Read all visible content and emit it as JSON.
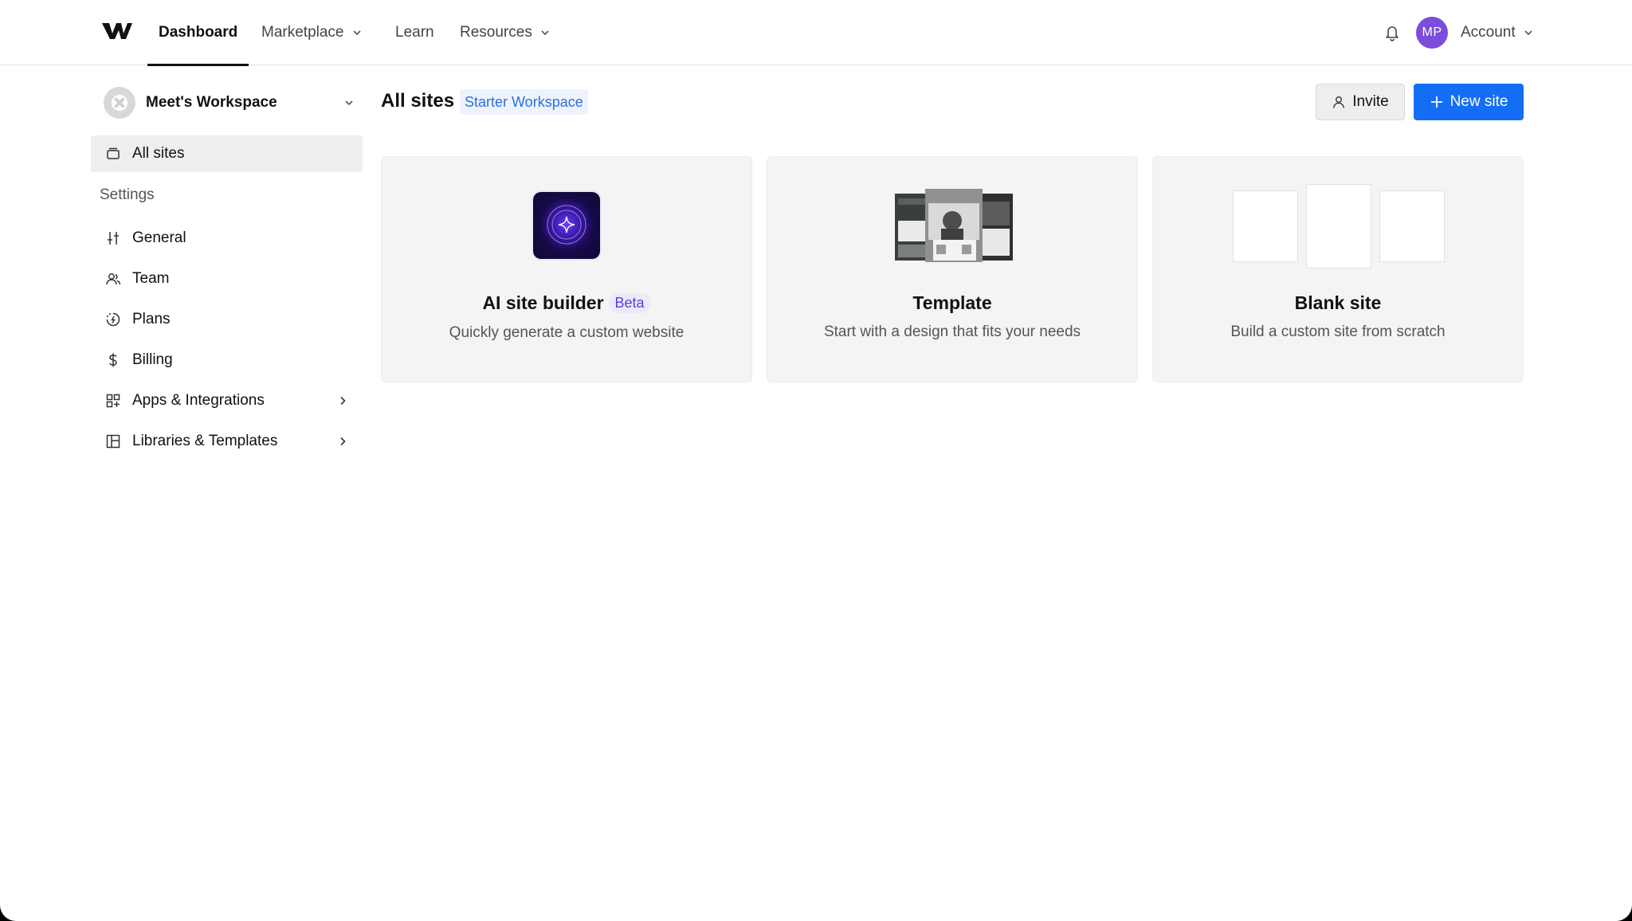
{
  "nav": {
    "dashboard": "Dashboard",
    "marketplace": "Marketplace",
    "learn": "Learn",
    "resources": "Resources",
    "avatar_initials": "MP",
    "account": "Account"
  },
  "sidebar": {
    "workspace_name": "Meet's Workspace",
    "all_sites": "All sites",
    "settings_heading": "Settings",
    "items": [
      {
        "label": "General",
        "icon": "sliders-icon"
      },
      {
        "label": "Team",
        "icon": "users-icon"
      },
      {
        "label": "Plans",
        "icon": "plans-icon"
      },
      {
        "label": "Billing",
        "icon": "dollar-icon"
      },
      {
        "label": "Apps & Integrations",
        "icon": "apps-icon"
      },
      {
        "label": "Libraries & Templates",
        "icon": "library-icon"
      }
    ]
  },
  "main": {
    "title": "All sites",
    "workspace_badge": "Starter Workspace",
    "invite_label": "Invite",
    "new_site_label": "New site",
    "cards": [
      {
        "title": "AI site builder",
        "badge": "Beta",
        "subtitle": "Quickly generate a custom website"
      },
      {
        "title": "Template",
        "subtitle": "Start with a design that fits your needs"
      },
      {
        "title": "Blank site",
        "subtitle": "Build a custom site from scratch"
      }
    ]
  },
  "colors": {
    "primary": "#146ef5",
    "avatar": "#7c4ddb",
    "badge_text": "#2e6fd9",
    "beta_text": "#5b3fd6"
  }
}
